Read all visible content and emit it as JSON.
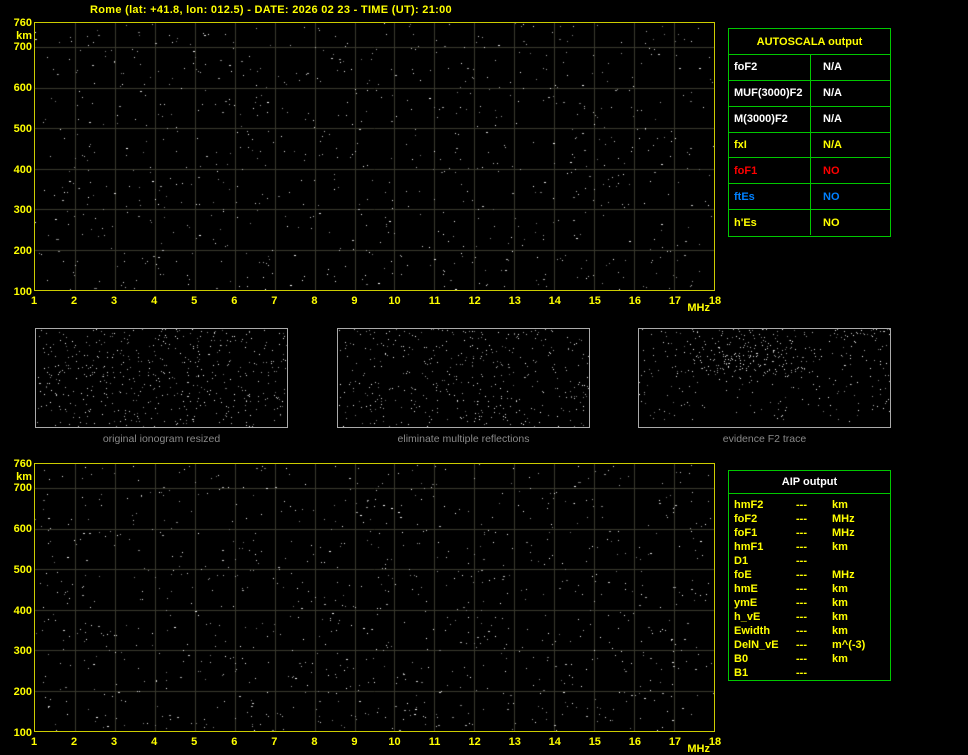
{
  "title": "Rome (lat: +41.8, lon: 012.5) - DATE: 2026 02 23 - TIME (UT): 21:00",
  "colors": {
    "accent_yellow": "#ffff00",
    "table_green": "#00c800",
    "plot_border": "#cccc00",
    "grid": "#3a3a2e",
    "panel_border": "#aaaaaa",
    "caption_gray": "#8a8a8a",
    "value_white": "#ffffff",
    "value_red": "#ff0000",
    "value_blue": "#0080ff"
  },
  "ionogram_axes": {
    "y_ticks": [
      "760",
      "700",
      "600",
      "500",
      "400",
      "300",
      "200",
      "100"
    ],
    "y_unit": "km",
    "x_ticks": [
      "1",
      "2",
      "3",
      "4",
      "5",
      "6",
      "7",
      "8",
      "9",
      "10",
      "11",
      "12",
      "13",
      "14",
      "15",
      "16",
      "17",
      "18"
    ],
    "x_unit": "MHz"
  },
  "autoscala_table": {
    "title": "AUTOSCALA output",
    "rows": [
      {
        "label": "foF2",
        "value": "N/A",
        "color": "#ffffff"
      },
      {
        "label": "MUF(3000)F2",
        "value": "N/A",
        "color": "#ffffff"
      },
      {
        "label": "M(3000)F2",
        "value": "N/A",
        "color": "#ffffff"
      },
      {
        "label": "fxI",
        "value": "N/A",
        "color": "#ffff00"
      },
      {
        "label": "foF1",
        "value": "NO",
        "color": "#ff0000"
      },
      {
        "label": "ftEs",
        "value": "NO",
        "color": "#0080ff"
      },
      {
        "label": "h'Es",
        "value": "NO",
        "color": "#ffff00"
      }
    ]
  },
  "panels": [
    {
      "caption": "original ionogram resized"
    },
    {
      "caption": "eliminate multiple reflections"
    },
    {
      "caption": "evidence F2 trace"
    }
  ],
  "aip_table": {
    "title": "AIP output",
    "rows": [
      {
        "label": "hmF2",
        "value": "---",
        "unit": "km"
      },
      {
        "label": "foF2",
        "value": "---",
        "unit": "MHz"
      },
      {
        "label": "foF1",
        "value": "---",
        "unit": "MHz"
      },
      {
        "label": "hmF1",
        "value": "---",
        "unit": "km"
      },
      {
        "label": "D1",
        "value": "---",
        "unit": ""
      },
      {
        "label": "foE",
        "value": "---",
        "unit": "MHz"
      },
      {
        "label": "hmE",
        "value": "---",
        "unit": "km"
      },
      {
        "label": "ymE",
        "value": "---",
        "unit": "km"
      },
      {
        "label": "h_vE",
        "value": "---",
        "unit": "km"
      },
      {
        "label": "Ewidth",
        "value": "---",
        "unit": "km"
      },
      {
        "label": "DelN_vE",
        "value": "---",
        "unit": "m^(-3)"
      },
      {
        "label": "B0",
        "value": "---",
        "unit": "km"
      },
      {
        "label": "B1",
        "value": "---",
        "unit": ""
      }
    ]
  }
}
